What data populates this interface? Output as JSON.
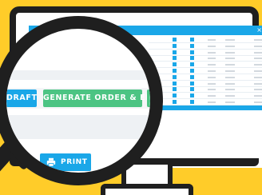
{
  "lens_view": {
    "buttons": [
      {
        "label": "DRAFT",
        "color": "#1aa7e8"
      },
      {
        "label": "GENERATE ORDER & EMAIL",
        "color": "#4cc483"
      },
      {
        "label": "G",
        "color": "#4cc483"
      }
    ],
    "print_button": {
      "label": "PRINT",
      "icon": "printer-icon",
      "color": "#1aa7e8"
    }
  },
  "mini_screen": {
    "close_glyph": "×",
    "accent": "#1aa7e8"
  },
  "colors": {
    "background": "#ffcc29",
    "frame": "#1f1f1f",
    "primary": "#1aa7e8",
    "success": "#4cc483"
  }
}
